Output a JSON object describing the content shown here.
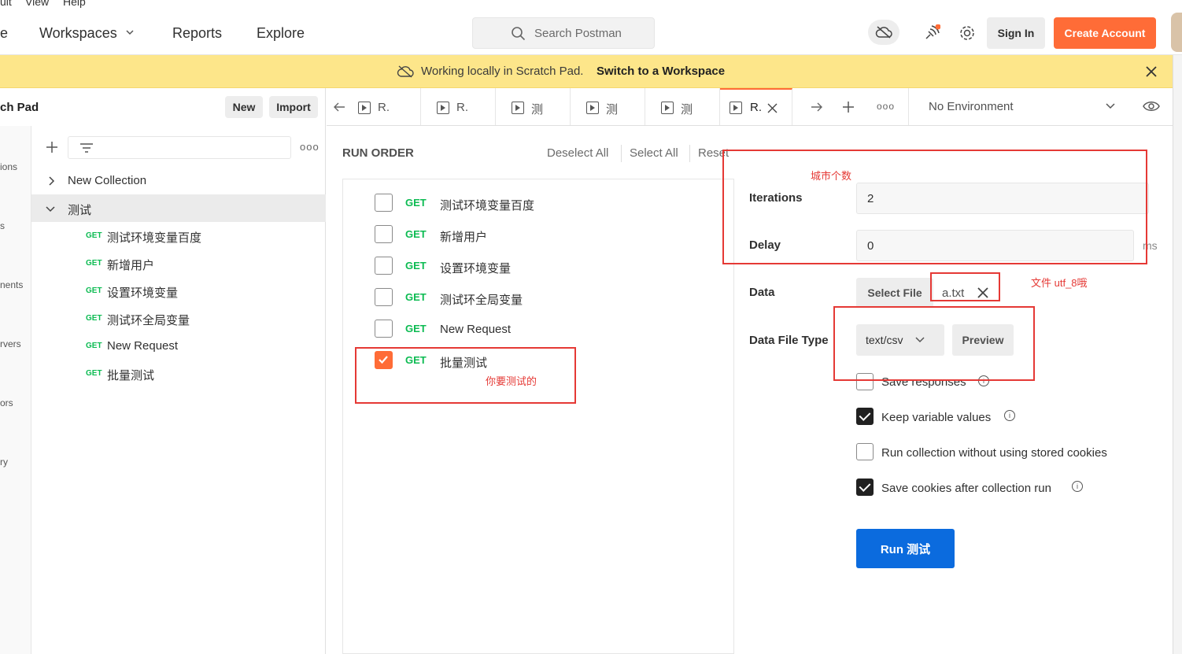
{
  "menubar": {
    "items": [
      "uit",
      "View",
      "Help"
    ]
  },
  "topnav": {
    "home": "e",
    "workspaces": "Workspaces",
    "reports": "Reports",
    "explore": "Explore",
    "search_placeholder": "Search Postman",
    "signin": "Sign In",
    "create_account": "Create Account"
  },
  "banner": {
    "text": "Working locally in Scratch Pad.",
    "link": "Switch to a Workspace"
  },
  "sidebar": {
    "title": "ch Pad",
    "new": "New",
    "import": "Import",
    "rail": [
      "ions",
      "s",
      "nents",
      "rvers",
      "ors",
      "ry"
    ],
    "tree": [
      {
        "label": "New Collection"
      },
      {
        "label": "测试"
      }
    ],
    "requests": [
      {
        "method": "GET",
        "label": "测试环境变量百度"
      },
      {
        "method": "GET",
        "label": "新增用户"
      },
      {
        "method": "GET",
        "label": "设置环境变量"
      },
      {
        "method": "GET",
        "label": "测试环全局变量"
      },
      {
        "method": "GET",
        "label": "New Request"
      },
      {
        "method": "GET",
        "label": "批量测试"
      }
    ]
  },
  "tabs": {
    "labels": [
      "R.",
      "R.",
      "测",
      "测",
      "测",
      "R."
    ],
    "environment": "No Environment"
  },
  "runner": {
    "run_order": "RUN ORDER",
    "deselect_all": "Deselect All",
    "select_all": "Select All",
    "reset": "Reset",
    "requests": [
      {
        "method": "GET",
        "label": "测试环境变量百度",
        "checked": false
      },
      {
        "method": "GET",
        "label": "新增用户",
        "checked": false
      },
      {
        "method": "GET",
        "label": "设置环境变量",
        "checked": false
      },
      {
        "method": "GET",
        "label": "测试环全局变量",
        "checked": false
      },
      {
        "method": "GET",
        "label": "New Request",
        "checked": false
      },
      {
        "method": "GET",
        "label": "批量测试",
        "checked": true
      }
    ],
    "iterations_label": "Iterations",
    "iterations_value": "2",
    "delay_label": "Delay",
    "delay_value": "0",
    "delay_unit": "ms",
    "data_label": "Data",
    "select_file": "Select File",
    "file_name": "a.txt",
    "data_file_type_label": "Data File Type",
    "data_file_type": "text/csv",
    "preview": "Preview",
    "options": [
      {
        "label": "Save responses",
        "checked": false
      },
      {
        "label": "Keep variable values",
        "checked": true
      },
      {
        "label": "Run collection without using stored cookies",
        "checked": false
      },
      {
        "label": "Save cookies after collection run",
        "checked": true
      }
    ],
    "run_button": "Run 测试"
  },
  "annotations": {
    "city_count": "城市个数",
    "file_utf8": "文件 utf_8哦",
    "want_test": "你要测试的"
  },
  "colors": {
    "accent": "#ff6c37",
    "primary": "#0b6bde",
    "get": "#0cbb52",
    "banner": "#fde68a",
    "annotation": "#e53935"
  }
}
